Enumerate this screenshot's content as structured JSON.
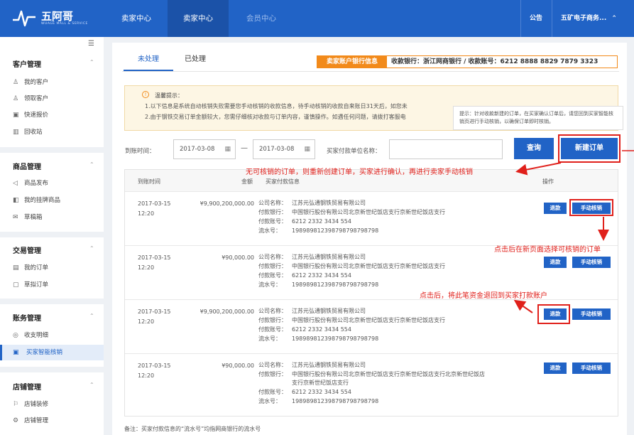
{
  "brand": {
    "name": "五阿哥",
    "sub": "WUAGE MALL & SERVICE"
  },
  "nav": {
    "items": [
      {
        "label": "卖家中心"
      },
      {
        "label": "卖家中心"
      },
      {
        "label": "会员中心"
      }
    ],
    "notice": "公告",
    "account": "五矿电子商务...",
    "account_caret": "⌃"
  },
  "sidebar": {
    "collapse": "☰",
    "groups": [
      {
        "title": "客户管理",
        "items": [
          {
            "icon": "user-icon",
            "glyph": "♙",
            "label": "我的客户"
          },
          {
            "icon": "user-add-icon",
            "glyph": "♙",
            "label": "领取客户"
          },
          {
            "icon": "quote-icon",
            "glyph": "▣",
            "label": "快速报价"
          },
          {
            "icon": "trash-icon",
            "glyph": "▥",
            "label": "回收站"
          }
        ]
      },
      {
        "title": "商品管理",
        "items": [
          {
            "icon": "send-icon",
            "glyph": "◁",
            "label": "商品发布"
          },
          {
            "icon": "tag-icon",
            "glyph": "◧",
            "label": "我的挂牌商品"
          },
          {
            "icon": "mail-icon",
            "glyph": "✉",
            "label": "草稿箱"
          }
        ]
      },
      {
        "title": "交易管理",
        "items": [
          {
            "icon": "order-icon",
            "glyph": "▤",
            "label": "我的订单"
          },
          {
            "icon": "draft-order-icon",
            "glyph": "▢",
            "label": "草拟订单"
          }
        ]
      },
      {
        "title": "账务管理",
        "items": [
          {
            "icon": "ledger-icon",
            "glyph": "◎",
            "label": "收支明细"
          },
          {
            "icon": "verify-icon",
            "glyph": "▣",
            "label": "买家智能核销"
          }
        ]
      },
      {
        "title": "店铺管理",
        "items": [
          {
            "icon": "decorate-icon",
            "glyph": "⚐",
            "label": "店铺装修"
          },
          {
            "icon": "settings-icon",
            "glyph": "⚙",
            "label": "店铺管理"
          }
        ]
      }
    ],
    "caret": "⌃"
  },
  "tabs": [
    {
      "label": "未处理"
    },
    {
      "label": "已处理"
    }
  ],
  "bank": {
    "label": "卖家账户银行信息",
    "info": "收款银行：浙江网商银行 / 收款账号：6212 8888 8829 7879 3323"
  },
  "notice": {
    "icon": "!",
    "title": "温馨提示：",
    "line1": "1.以下信息是系统自动核销失败需要您手动核销的收款信息，待手动核销的收款自来账日31天后，如您未",
    "line2": "2.由于钢铁交易订单金额较大，您需仔细核对收款与订单内容，谨慎操作。如遇任何问题，请拨打客服电",
    "tip": "提示：针对收款新建的订单，在买家确认订单后，请您回到买家智能核销页进行手动核销，以确保订单即时核销。"
  },
  "filter": {
    "date_label": "到账时间：",
    "date_from": "2017-03-08",
    "date_to": "2017-03-08",
    "dash": "—",
    "payer_label": "买家付款单位名称：",
    "payer_value": "",
    "search_label": "查询",
    "new_order_label": "新建订单",
    "cal": "▦"
  },
  "table": {
    "headers": [
      "到账时间",
      "金额",
      "买家付款信息",
      "操作"
    ],
    "info_keys": [
      "公司名称：",
      "付款银行：",
      "付款账号：",
      "流水号："
    ],
    "rows": [
      {
        "date": "2017-03-15",
        "time": "12:20",
        "amount": "¥9,900,200,000.00",
        "company": "江苏元弘通钢铁贸易有限公司",
        "bank": "中国银行股份有限公司北京新世纪饭店支行京新世纪饭店支行",
        "bank2": "",
        "account": "6212 2332 3434 554",
        "serial": "198989812398798798798798"
      },
      {
        "date": "2017-03-15",
        "time": "12:20",
        "amount": "¥90,000.00",
        "company": "江苏元弘通钢铁贸易有限公司",
        "bank": "中国银行股份有限公司北京新世纪饭店支行京新世纪饭店支行",
        "bank2": "",
        "account": "6212 2332 3434 554",
        "serial": "198989812398798798798798"
      },
      {
        "date": "2017-03-15",
        "time": "12:20",
        "amount": "¥9,900,200,000.00",
        "company": "江苏元弘通钢铁贸易有限公司",
        "bank": "中国银行股份有限公司北京新世纪饭店支行京新世纪饭店支行",
        "bank2": "",
        "account": "6212 2332 3434 554",
        "serial": "198989812398798798798798"
      },
      {
        "date": "2017-03-15",
        "time": "12:20",
        "amount": "¥90,000.00",
        "company": "江苏元弘通钢铁贸易有限公司",
        "bank": "中国银行股份有限公司北京新世纪饭店支行京新世纪饭店支行北京新世纪饭店",
        "bank2": "支行京新世纪饭店支行",
        "account": "6212 2332 3434 554",
        "serial": "198989812398798798798798"
      }
    ],
    "refund_label": "退款",
    "manual_label": "手动核销"
  },
  "footer": {
    "note": "备注：买家付款信息的“流水号”均指网商银行的流水号"
  },
  "annotations": {
    "a1": "无可核销的订单，则重新创建订单，买家进行确认，再进行卖家手动核销",
    "a2": "点击后在新页面选择可核销的订单",
    "a3": "点击后，将此笔资金退回到买家打款账户"
  },
  "colors": {
    "primary": "#2163c6",
    "accent": "#f28a1a",
    "annotation": "#e0201b"
  }
}
